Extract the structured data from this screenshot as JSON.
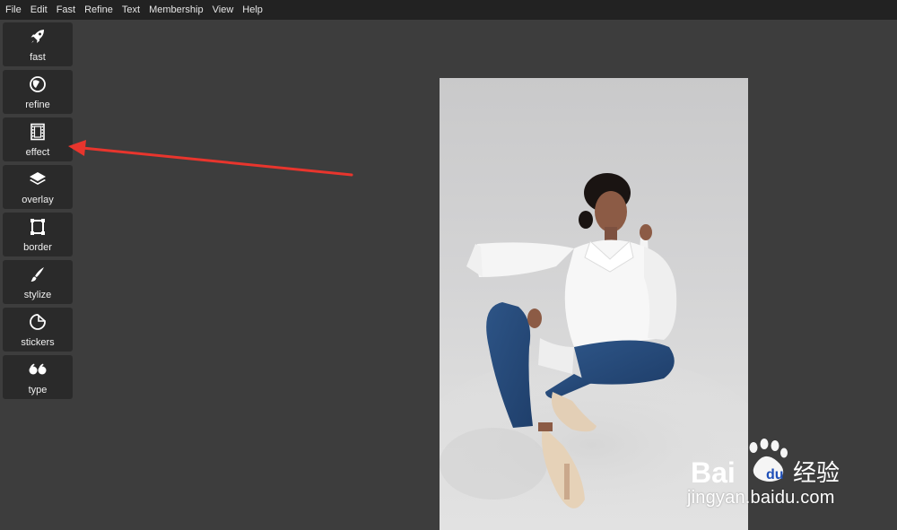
{
  "menubar": {
    "items": [
      "File",
      "Edit",
      "Fast",
      "Refine",
      "Text",
      "Membership",
      "View",
      "Help"
    ]
  },
  "toolbar": {
    "tools": [
      {
        "label": "fast",
        "icon": "rocket-icon"
      },
      {
        "label": "refine",
        "icon": "refine-icon"
      },
      {
        "label": "effect",
        "icon": "film-icon"
      },
      {
        "label": "overlay",
        "icon": "layers-icon"
      },
      {
        "label": "border",
        "icon": "border-frame-icon"
      },
      {
        "label": "stylize",
        "icon": "brush-icon"
      },
      {
        "label": "stickers",
        "icon": "sticker-icon"
      },
      {
        "label": "type",
        "icon": "quote-icon"
      }
    ]
  },
  "annotation": {
    "color": "#e8352d"
  },
  "watermark": {
    "logo_text": "Bai",
    "logo_text_cn": "经验",
    "url": "jingyan.baidu.com"
  },
  "colors": {
    "background": "#3d3d3d",
    "menubar": "#222222",
    "tool_button": "#2a2a2a"
  }
}
